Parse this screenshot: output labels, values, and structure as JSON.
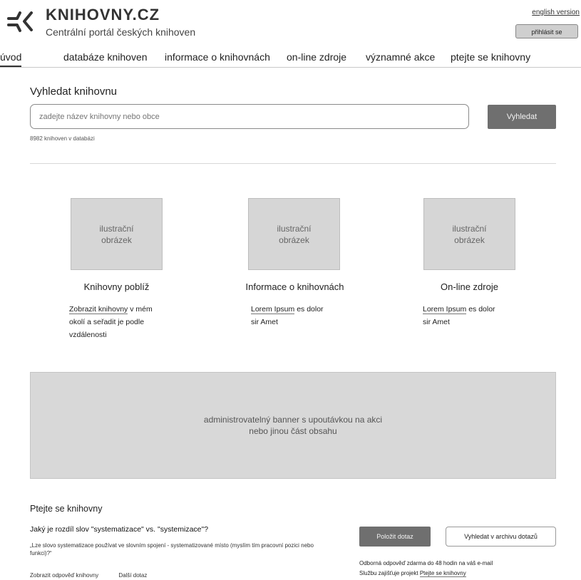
{
  "header": {
    "brand_title": "KNIHOVNY.CZ",
    "brand_subtitle": "Centrální portál českých knihoven",
    "english_link": "english version",
    "login_button": "přihlásit se"
  },
  "nav": {
    "items": [
      {
        "label": "úvod",
        "active": true
      },
      {
        "label": "databáze knihoven"
      },
      {
        "label": "informace o knihovnách"
      },
      {
        "label": "on-line zdroje"
      },
      {
        "label": "významné akce"
      },
      {
        "label": "ptejte se knihovny"
      }
    ]
  },
  "search": {
    "title": "Vyhledat knihovnu",
    "placeholder": "zadejte název knihovny nebo obce",
    "button": "Vyhledat",
    "count_text": "8982 knihoven v databázi"
  },
  "cards": [
    {
      "image_line1": "ilustrační",
      "image_line2": "obrázek",
      "title": "Knihovny poblíž",
      "link": "Zobrazit knihovny",
      "text1": " v mém",
      "text2": "okolí a seřadit je podle",
      "text3": "vzdálenosti"
    },
    {
      "image_line1": "ilustrační",
      "image_line2": "obrázek",
      "title": "Informace o knihovnách",
      "link": "Lorem Ipsum",
      "text1": " es dolor",
      "text2": "sir Amet"
    },
    {
      "image_line1": "ilustrační",
      "image_line2": "obrázek",
      "title": "On-line zdroje",
      "link": "Lorem Ipsum",
      "text1": " es dolor",
      "text2": "sir Amet"
    }
  ],
  "banner": {
    "line1": "administrovatelný banner s upoutávkou na akci",
    "line2": "nebo jinou část obsahu"
  },
  "ask": {
    "title": "Ptejte se knihovny",
    "question": "Jaký je rozdíl slov \"systematizace\" vs. \"systemizace\"?",
    "question_text": "„Lze slovo systematizace používat ve slovním spojení - systematizované místo (myslím tím pracovní pozici nebo funkci)?“",
    "show_answer": "Zobrazit odpověď knihovny",
    "next_question": "Další dotaz",
    "ask_button": "Položit dotaz",
    "archive_button": "Vyhledat v archivu dotazů",
    "info1": "Odborná odpověď zdarma do 48 hodin na váš e-mail",
    "info2_prefix": "Službu zajišťuje projekt ",
    "info2_link": "Ptejte se knihovny"
  }
}
